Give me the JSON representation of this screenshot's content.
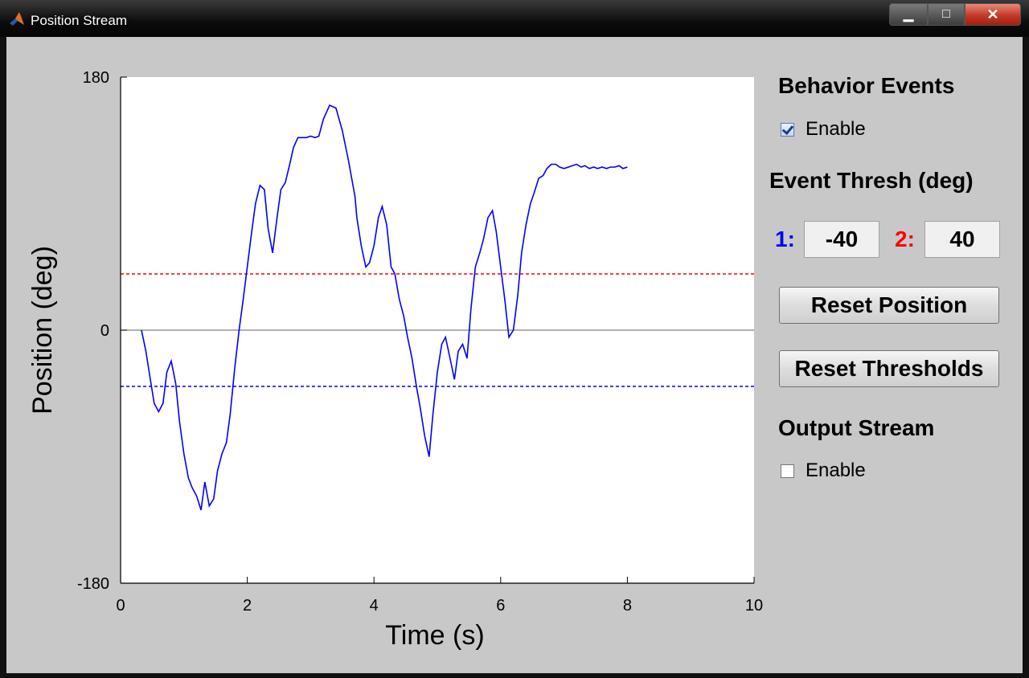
{
  "window": {
    "title": "Position Stream",
    "icon": "matlab-icon",
    "controls": {
      "minimize": "▁",
      "maximize": "□",
      "close": "✕"
    }
  },
  "plot": {
    "xlabel": "Time (s)",
    "ylabel": "Position (deg)",
    "xticks": [
      "0",
      "2",
      "4",
      "6",
      "8",
      "10"
    ],
    "yticks": [
      "180",
      "0",
      "-180"
    ]
  },
  "chart_data": {
    "type": "line",
    "title": "",
    "xlabel": "Time (s)",
    "ylabel": "Position (deg)",
    "xlim": [
      0,
      10
    ],
    "ylim": [
      -180,
      180
    ],
    "grid": false,
    "reference_lines": [
      {
        "y": 0,
        "color": "#808080",
        "style": "solid"
      },
      {
        "y": 40,
        "color": "#ff0000",
        "style": "dashed"
      },
      {
        "y": -40,
        "color": "#0000ff",
        "style": "dashed"
      }
    ],
    "series": [
      {
        "color": "#0000ff",
        "x": [
          0.33,
          0.4,
          0.47,
          0.53,
          0.6,
          0.67,
          0.73,
          0.8,
          0.87,
          0.93,
          1.0,
          1.07,
          1.13,
          1.2,
          1.27,
          1.33,
          1.4,
          1.47,
          1.53,
          1.6,
          1.67,
          1.73,
          1.8,
          1.87,
          1.93,
          2.0,
          2.07,
          2.13,
          2.2,
          2.27,
          2.33,
          2.4,
          2.47,
          2.53,
          2.6,
          2.67,
          2.73,
          2.8,
          2.87,
          2.93,
          3.0,
          3.07,
          3.13,
          3.2,
          3.3,
          3.4,
          3.5,
          3.6,
          3.7,
          3.73,
          3.8,
          3.87,
          3.93,
          4.0,
          4.07,
          4.13,
          4.2,
          4.27,
          4.33,
          4.4,
          4.47,
          4.53,
          4.6,
          4.67,
          4.73,
          4.8,
          4.87,
          4.93,
          5.0,
          5.07,
          5.13,
          5.2,
          5.27,
          5.33,
          5.4,
          5.47,
          5.53,
          5.6,
          5.67,
          5.73,
          5.8,
          5.87,
          5.93,
          6.0,
          6.07,
          6.13,
          6.2,
          6.27,
          6.33,
          6.4,
          6.47,
          6.53,
          6.6,
          6.67,
          6.73,
          6.8,
          6.87,
          6.93,
          7.0,
          7.07,
          7.13,
          7.2,
          7.27,
          7.33,
          7.4,
          7.47,
          7.53,
          7.6,
          7.67,
          7.73,
          7.8,
          7.87,
          7.93,
          8.0
        ],
        "y": [
          0,
          -15,
          -35,
          -52,
          -58,
          -52,
          -30,
          -22,
          -38,
          -65,
          -88,
          -105,
          -112,
          -118,
          -128,
          -108,
          -125,
          -120,
          -100,
          -88,
          -80,
          -60,
          -28,
          0,
          20,
          45,
          70,
          90,
          103,
          100,
          72,
          55,
          80,
          100,
          105,
          118,
          130,
          137,
          137,
          137,
          138,
          137,
          138,
          150,
          160,
          158,
          142,
          120,
          95,
          80,
          60,
          45,
          48,
          60,
          80,
          88,
          75,
          45,
          40,
          22,
          10,
          -5,
          -20,
          -40,
          -55,
          -75,
          -90,
          -60,
          -30,
          -10,
          -5,
          -20,
          -35,
          -15,
          -10,
          -20,
          15,
          45,
          55,
          65,
          80,
          85,
          70,
          45,
          20,
          -5,
          0,
          25,
          55,
          75,
          90,
          98,
          108,
          110,
          115,
          118,
          118,
          116,
          115,
          116,
          117,
          118,
          116,
          117,
          115,
          116,
          115,
          116,
          115,
          116,
          116,
          117,
          115,
          116
        ]
      }
    ]
  },
  "panel": {
    "behavior_heading": "Behavior Events",
    "behavior_enable_label": "Enable",
    "behavior_enabled": true,
    "thresh_heading": "Event Thresh (deg)",
    "thresh1_label": "1:",
    "thresh1_color": "#0000ff",
    "thresh1_value": "-40",
    "thresh2_label": "2:",
    "thresh2_color": "#ff0000",
    "thresh2_value": "40",
    "reset_position_label": "Reset Position",
    "reset_thresholds_label": "Reset Thresholds",
    "output_heading": "Output Stream",
    "output_enable_label": "Enable",
    "output_enabled": false
  }
}
